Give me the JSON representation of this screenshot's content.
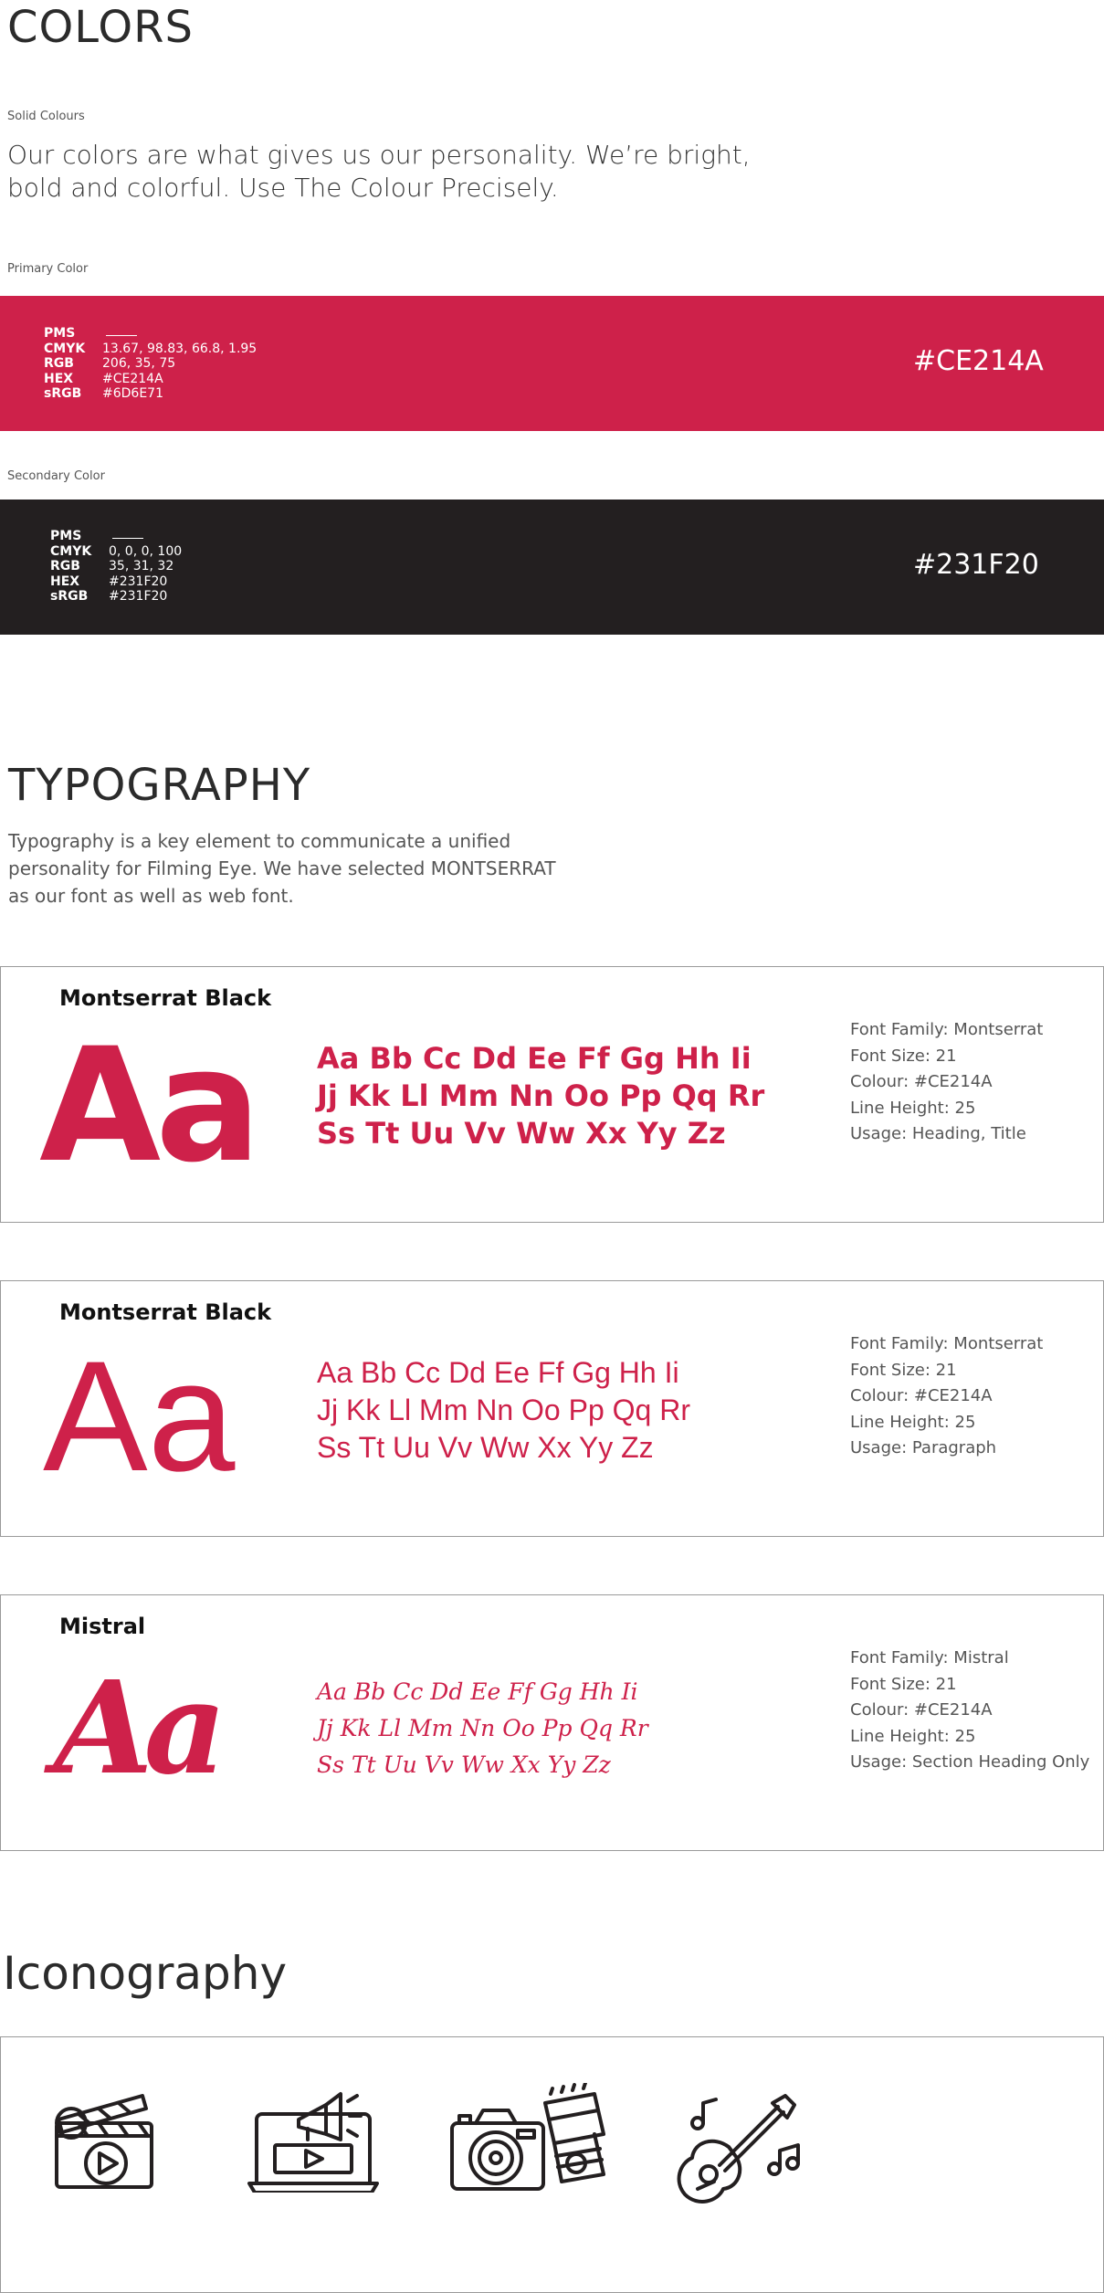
{
  "colors": {
    "heading": "COLORS",
    "solid_label": "Solid Colours",
    "intro_line1": "Our colors are what gives us our personality. We’re bright,",
    "intro_line2": "bold and colorful. Use The Colour Precisely.",
    "primary": {
      "label": "Primary Color",
      "color": "#CE214A",
      "hex_display": "#CE214A",
      "specs": [
        {
          "key": "PMS",
          "value": ""
        },
        {
          "key": "CMYK",
          "value": "13.67, 98.83, 66.8, 1.95"
        },
        {
          "key": "RGB",
          "value": "206, 35, 75"
        },
        {
          "key": "HEX",
          "value": "#CE214A"
        },
        {
          "key": "sRGB",
          "value": "#6D6E71"
        }
      ]
    },
    "secondary": {
      "label": "Secondary Color",
      "color": "#231F20",
      "hex_display": "#231F20",
      "specs": [
        {
          "key": "PMS",
          "value": ""
        },
        {
          "key": "CMYK",
          "value": "0, 0, 0, 100"
        },
        {
          "key": "RGB",
          "value": "35, 31, 32"
        },
        {
          "key": "HEX",
          "value": "#231F20"
        },
        {
          "key": "sRGB",
          "value": "#231F20"
        }
      ]
    }
  },
  "typography": {
    "heading": "TYPOGRAPHY",
    "intro_line1": "Typography is a key element to communicate a unified",
    "intro_line2": "personality for Filming Eye.  We have selected MONTSERRAT",
    "intro_line3": "as our font as well as web font.",
    "cards": [
      {
        "title": "Montserrat Black",
        "sample": "Aa",
        "alphabet": [
          "Aa Bb Cc Dd Ee Ff Gg Hh Ii",
          "Jj Kk Ll Mm Nn Oo Pp Qq Rr",
          "Ss Tt Uu Vv Ww Xx Yy Zz"
        ],
        "meta": [
          "Font Family: Montserrat",
          "Font Size: 21",
          "Colour: #CE214A",
          "Line Height: 25",
          "Usage: Heading, Title"
        ]
      },
      {
        "title": "Montserrat Black",
        "sample": "Aa",
        "alphabet": [
          "Aa Bb Cc Dd Ee Ff Gg Hh Ii",
          "Jj Kk Ll Mm Nn Oo Pp Qq Rr",
          "Ss Tt Uu Vv Ww Xx Yy Zz"
        ],
        "meta": [
          "Font Family: Montserrat",
          "Font Size: 21",
          "Colour: #CE214A",
          "Line Height: 25",
          "Usage: Paragraph"
        ]
      },
      {
        "title": "Mistral",
        "sample": "Aa",
        "alphabet": [
          "Aa Bb Cc Dd Ee Ff Gg Hh Ii",
          "Jj Kk Ll Mm Nn Oo Pp Qq Rr",
          "Ss Tt Uu Vv Ww Xx Yy Zz"
        ],
        "meta": [
          "Font Family: Mistral",
          "Font Size: 21",
          "Colour: #CE214A",
          "Line Height: 25",
          "Usage: Section Heading Only"
        ]
      }
    ]
  },
  "iconography": {
    "heading": "Iconography",
    "icons": [
      "clapperboard-icon",
      "laptop-video-megaphone-icon",
      "camera-lens-icon",
      "guitar-music-icon"
    ]
  }
}
